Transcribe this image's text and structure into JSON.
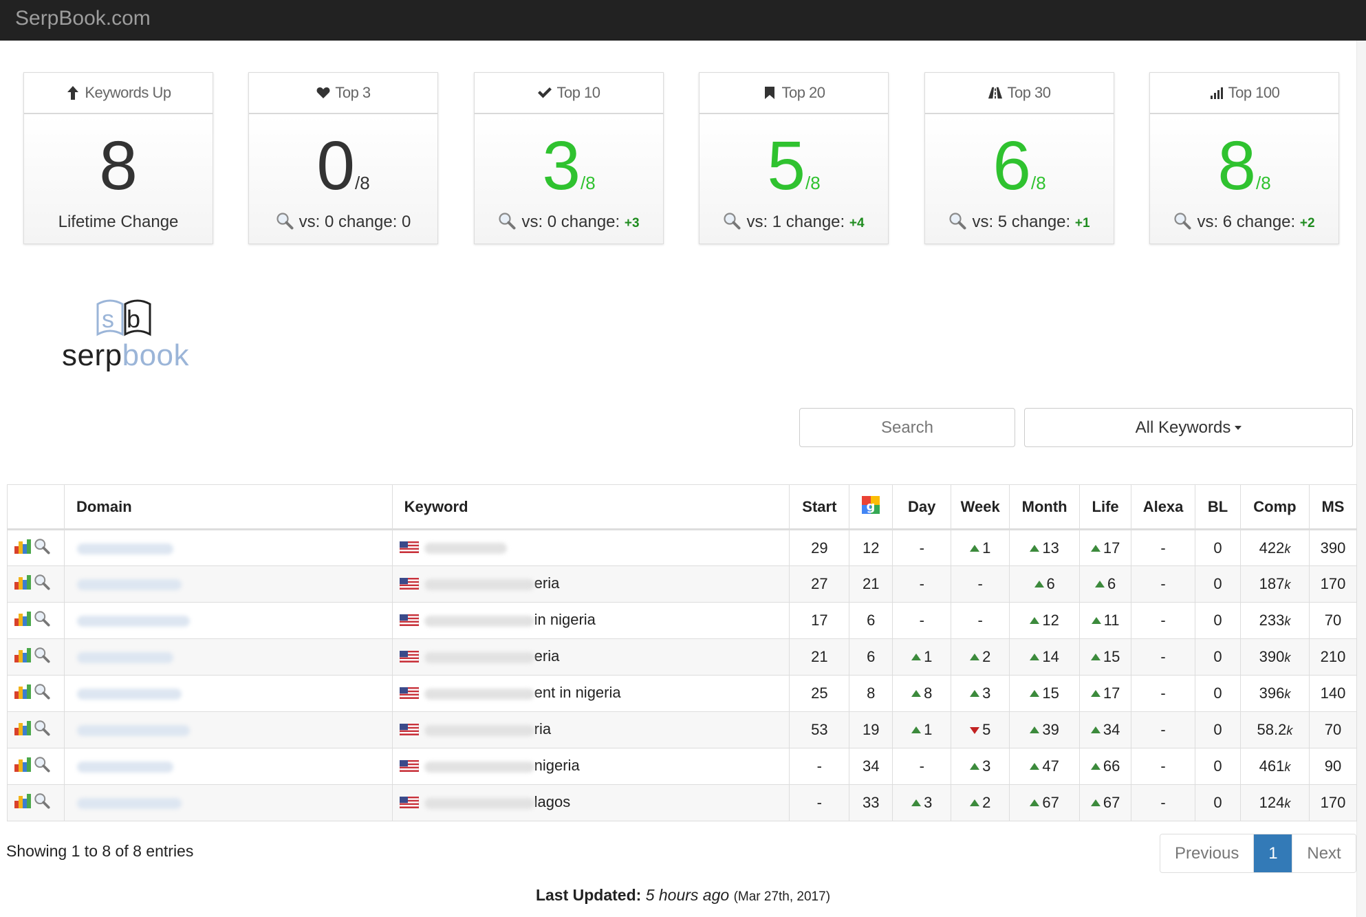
{
  "app": {
    "brand": "SerpBook.com"
  },
  "logo": {
    "part1": "serp",
    "part2": "book"
  },
  "cards": [
    {
      "title": "Keywords Up",
      "icon": "arrow-up-icon",
      "value": "8",
      "denom": "",
      "footer": "Lifetime Change"
    },
    {
      "title": "Top 3",
      "icon": "heart-icon",
      "value": "0",
      "denom": "/8",
      "vs_label": "vs: 0 change: 0",
      "change": ""
    },
    {
      "title": "Top 10",
      "icon": "checkmark-icon",
      "value": "3",
      "denom": "/8",
      "vs_label": "vs: 0 change:",
      "change": "+3"
    },
    {
      "title": "Top 20",
      "icon": "bookmark-icon",
      "value": "5",
      "denom": "/8",
      "vs_label": "vs: 1 change:",
      "change": "+4"
    },
    {
      "title": "Top 30",
      "icon": "road-icon",
      "value": "6",
      "denom": "/8",
      "vs_label": "vs: 5 change:",
      "change": "+1"
    },
    {
      "title": "Top 100",
      "icon": "signal-icon",
      "value": "8",
      "denom": "/8",
      "vs_label": "vs: 6 change:",
      "change": "+2"
    }
  ],
  "controls": {
    "search_placeholder": "Search",
    "filter_label": "All Keywords"
  },
  "table": {
    "headers": [
      "",
      "Domain",
      "Keyword",
      "Start",
      "",
      "Day",
      "Week",
      "Month",
      "Life",
      "Alexa",
      "BL",
      "Comp",
      "MS"
    ],
    "rows": [
      {
        "keyword_visible": "",
        "start": "29",
        "google": "12",
        "day": "-",
        "day_dir": "",
        "week": "1",
        "week_dir": "up",
        "month": "13",
        "month_dir": "up",
        "life": "17",
        "life_dir": "up",
        "alexa": "-",
        "bl": "0",
        "comp": "422",
        "comp_unit": "k",
        "ms": "390"
      },
      {
        "keyword_visible": "eria",
        "start": "27",
        "google": "21",
        "day": "-",
        "day_dir": "",
        "week": "-",
        "week_dir": "",
        "month": "6",
        "month_dir": "up",
        "life": "6",
        "life_dir": "up",
        "alexa": "-",
        "bl": "0",
        "comp": "187",
        "comp_unit": "k",
        "ms": "170"
      },
      {
        "keyword_visible": "in nigeria",
        "start": "17",
        "google": "6",
        "day": "-",
        "day_dir": "",
        "week": "-",
        "week_dir": "",
        "month": "12",
        "month_dir": "up",
        "life": "11",
        "life_dir": "up",
        "alexa": "-",
        "bl": "0",
        "comp": "233",
        "comp_unit": "k",
        "ms": "70"
      },
      {
        "keyword_visible": "eria",
        "start": "21",
        "google": "6",
        "day": "1",
        "day_dir": "up",
        "week": "2",
        "week_dir": "up",
        "month": "14",
        "month_dir": "up",
        "life": "15",
        "life_dir": "up",
        "alexa": "-",
        "bl": "0",
        "comp": "390",
        "comp_unit": "k",
        "ms": "210"
      },
      {
        "keyword_visible": "ent in nigeria",
        "start": "25",
        "google": "8",
        "day": "8",
        "day_dir": "up",
        "week": "3",
        "week_dir": "up",
        "month": "15",
        "month_dir": "up",
        "life": "17",
        "life_dir": "up",
        "alexa": "-",
        "bl": "0",
        "comp": "396",
        "comp_unit": "k",
        "ms": "140"
      },
      {
        "keyword_visible": "ria",
        "start": "53",
        "google": "19",
        "day": "1",
        "day_dir": "up",
        "week": "5",
        "week_dir": "down",
        "month": "39",
        "month_dir": "up",
        "life": "34",
        "life_dir": "up",
        "alexa": "-",
        "bl": "0",
        "comp": "58.2",
        "comp_unit": "k",
        "ms": "70"
      },
      {
        "keyword_visible": "nigeria",
        "start": "-",
        "google": "34",
        "day": "-",
        "day_dir": "",
        "week": "3",
        "week_dir": "up",
        "month": "47",
        "month_dir": "up",
        "life": "66",
        "life_dir": "up",
        "alexa": "-",
        "bl": "0",
        "comp": "461",
        "comp_unit": "k",
        "ms": "90"
      },
      {
        "keyword_visible": "lagos",
        "start": "-",
        "google": "33",
        "day": "3",
        "day_dir": "up",
        "week": "2",
        "week_dir": "up",
        "month": "67",
        "month_dir": "up",
        "life": "67",
        "life_dir": "up",
        "alexa": "-",
        "bl": "0",
        "comp": "124",
        "comp_unit": "k",
        "ms": "170"
      }
    ]
  },
  "footer": {
    "showing": "Showing 1 to 8 of 8 entries",
    "prev": "Previous",
    "page": "1",
    "next": "Next",
    "updated_label": "Last Updated:",
    "updated_ago": "5 hours ago",
    "updated_date": "(Mar 27th, 2017)"
  },
  "colors": {
    "navbar": "#222222",
    "green": "#2fc22f",
    "up_arrow": "#3c8a3c",
    "down_arrow": "#c22222",
    "active_page": "#337ab7"
  }
}
